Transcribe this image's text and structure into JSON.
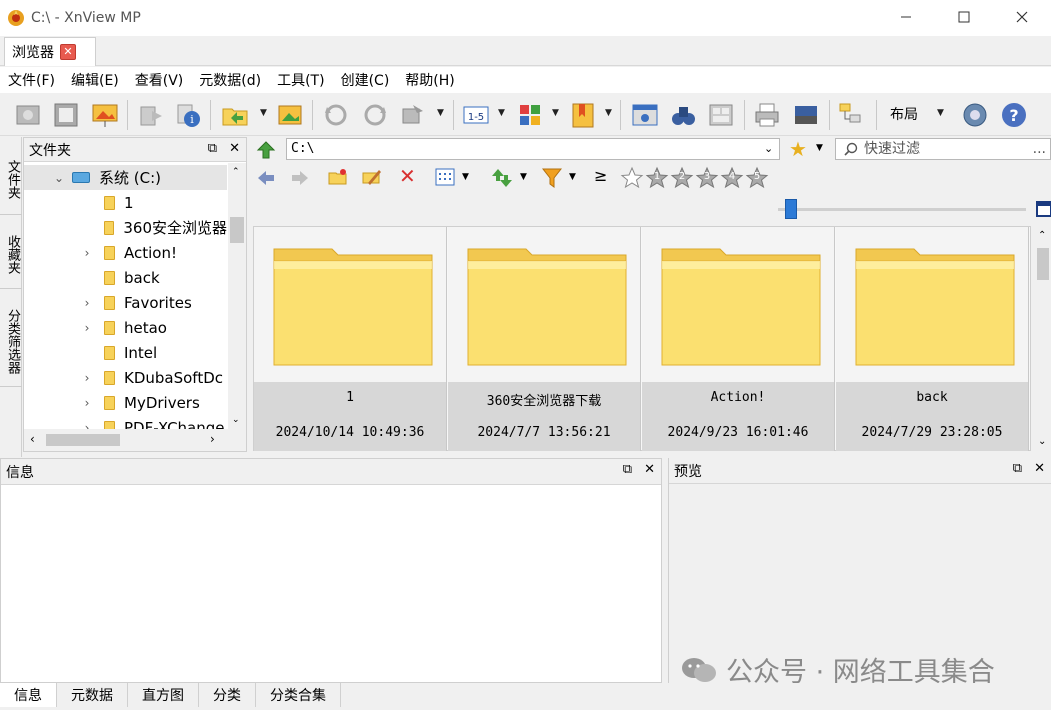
{
  "window": {
    "title": "C:\\ - XnView MP"
  },
  "tab": {
    "label": "浏览器"
  },
  "menu": [
    "文件(F)",
    "编辑(E)",
    "查看(V)",
    "元数据(d)",
    "工具(T)",
    "创建(C)",
    "帮助(H)"
  ],
  "toolbar": {
    "layout_label": "布局",
    "ratio_label": "1-5"
  },
  "side_tabs": [
    "文件夹",
    "收藏夹",
    "分类筛选器"
  ],
  "folder_panel": {
    "title": "文件夹",
    "tree": [
      {
        "label": "系统 (C:)",
        "expander": "v",
        "selected": true
      },
      {
        "label": "1",
        "expander": ""
      },
      {
        "label": "360安全浏览器",
        "expander": ""
      },
      {
        "label": "Action!",
        "expander": ">"
      },
      {
        "label": "back",
        "expander": ""
      },
      {
        "label": "Favorites",
        "expander": ">"
      },
      {
        "label": "hetao",
        "expander": ">"
      },
      {
        "label": "Intel",
        "expander": ""
      },
      {
        "label": "KDubaSoftDc",
        "expander": ">"
      },
      {
        "label": "MyDrivers",
        "expander": ">"
      },
      {
        "label": "PDF-XChange",
        "expander": ">"
      }
    ]
  },
  "address": {
    "path": "C:\\",
    "filter_placeholder": "快速过滤",
    "more": "..."
  },
  "rating_op": "≥",
  "rating_stars": [
    "1",
    "2",
    "3",
    "4",
    "5"
  ],
  "thumbnails": [
    {
      "name": "1",
      "date": "2024/10/14 10:49:36"
    },
    {
      "name": "360安全浏览器下载",
      "date": "2024/7/7 13:56:21"
    },
    {
      "name": "Action!",
      "date": "2024/9/23 16:01:46"
    },
    {
      "name": "back",
      "date": "2024/7/29 23:28:05"
    }
  ],
  "info_panel": {
    "title": "信息"
  },
  "preview_panel": {
    "title": "预览"
  },
  "bottom_tabs": [
    "信息",
    "元数据",
    "直方图",
    "分类",
    "分类合集"
  ],
  "watermark": "公众号 · 网络工具集合",
  "colors": {
    "folder": "#f7d25a",
    "accent": "#2c7ad6",
    "close_red": "#e85a4f"
  }
}
